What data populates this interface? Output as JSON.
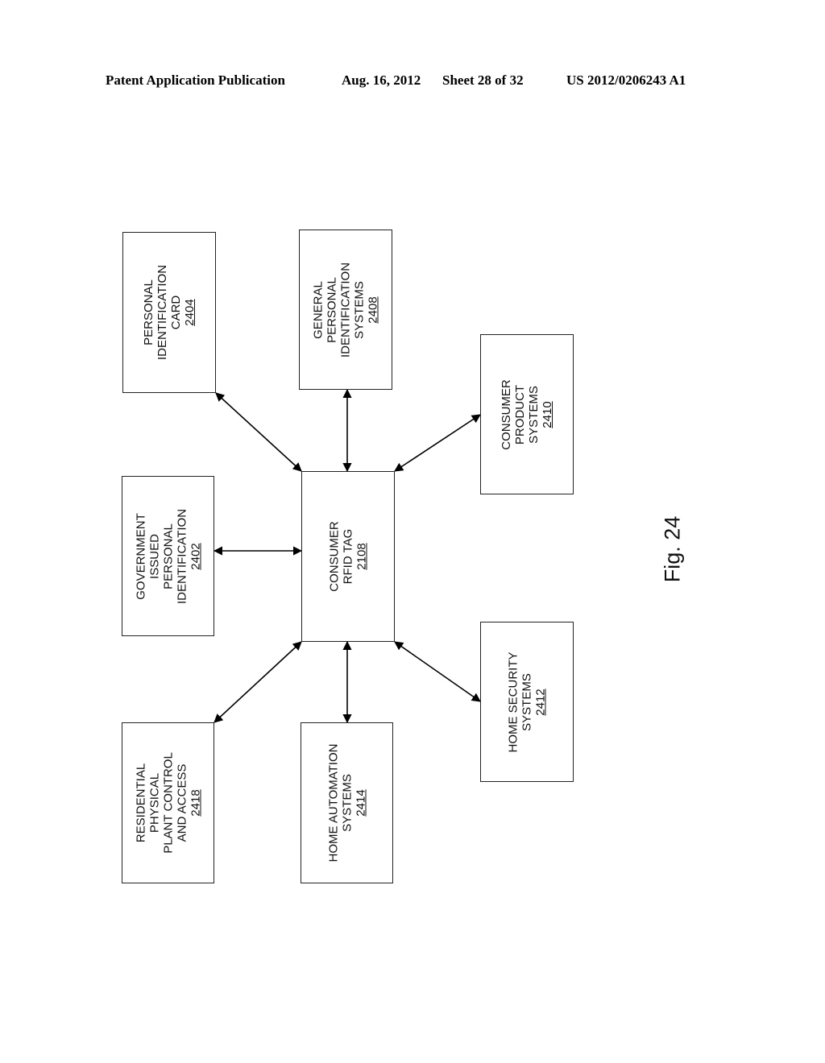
{
  "header": {
    "left": "Patent Application Publication",
    "date": "Aug. 16, 2012",
    "sheet": "Sheet 28 of 32",
    "number": "US 2012/0206243 A1"
  },
  "figure_label": "Fig. 24",
  "boxes": {
    "b2404": {
      "lines": [
        "PERSONAL",
        "IDENTIFICATION",
        "CARD"
      ],
      "ref": "2404"
    },
    "b2408": {
      "lines": [
        "GENERAL",
        "PERSONAL",
        "IDENTIFICATION",
        "SYSTEMS"
      ],
      "ref": "2408"
    },
    "b2410": {
      "lines": [
        "CONSUMER",
        "PRODUCT",
        "SYSTEMS"
      ],
      "ref": "2410"
    },
    "b2402": {
      "lines": [
        "GOVERNMENT",
        "ISSUED",
        "PERSONAL",
        "IDENTIFICATION"
      ],
      "ref": "2402"
    },
    "b2108": {
      "lines": [
        "CONSUMER",
        "RFID TAG"
      ],
      "ref": "2108"
    },
    "b2418": {
      "lines": [
        "RESIDENTIAL",
        "PHYSICAL",
        "PLANT CONTROL",
        "AND ACCESS"
      ],
      "ref": "2418"
    },
    "b2414": {
      "lines": [
        "HOME AUTOMATION",
        "SYSTEMS"
      ],
      "ref": "2414"
    },
    "b2412": {
      "lines": [
        "HOME SECURITY",
        "SYSTEMS"
      ],
      "ref": "2412"
    }
  },
  "connections": [
    {
      "from": "2108",
      "to": "2404",
      "type": "bidirectional"
    },
    {
      "from": "2108",
      "to": "2408",
      "type": "bidirectional"
    },
    {
      "from": "2108",
      "to": "2410",
      "type": "bidirectional"
    },
    {
      "from": "2108",
      "to": "2402",
      "type": "bidirectional"
    },
    {
      "from": "2108",
      "to": "2418",
      "type": "bidirectional"
    },
    {
      "from": "2108",
      "to": "2414",
      "type": "bidirectional"
    },
    {
      "from": "2108",
      "to": "2412",
      "type": "bidirectional"
    }
  ]
}
